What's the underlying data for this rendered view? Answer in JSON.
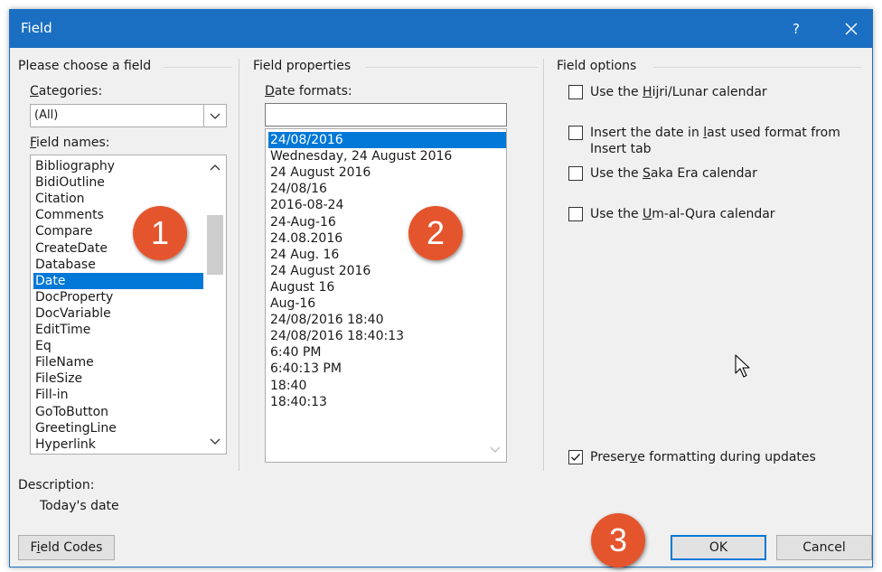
{
  "window": {
    "title": "Field",
    "help_label": "?"
  },
  "left": {
    "group_title": "Please choose a field",
    "categories_label": "Categories:",
    "categories_accel": "C",
    "categories_rest": "ategories:",
    "categories_value": "(All)",
    "field_names_accel": "F",
    "field_names_rest": "ield names:",
    "field_names": [
      "Bibliography",
      "BidiOutline",
      "Citation",
      "Comments",
      "Compare",
      "CreateDate",
      "Database",
      "Date",
      "DocProperty",
      "DocVariable",
      "EditTime",
      "Eq",
      "FileName",
      "FileSize",
      "Fill-in",
      "GoToButton",
      "GreetingLine",
      "Hyperlink"
    ],
    "selected_field": "Date",
    "description_label": "Description:",
    "description_text": "Today's date",
    "field_codes_accel": "i",
    "field_codes_pre": "F",
    "field_codes_post": "eld Codes"
  },
  "middle": {
    "group_title": "Field properties",
    "date_formats_accel": "D",
    "date_formats_rest": "ate formats:",
    "date_format_value": "",
    "date_formats": [
      "24/08/2016",
      "Wednesday, 24 August 2016",
      "24 August 2016",
      "24/08/16",
      "2016-08-24",
      "24-Aug-16",
      "24.08.2016",
      "24 Aug. 16",
      "24 August 2016",
      "August 16",
      "Aug-16",
      "24/08/2016 18:40",
      "24/08/2016 18:40:13",
      "6:40 PM",
      "6:40:13 PM",
      "18:40",
      "18:40:13"
    ],
    "selected_format": "24/08/2016"
  },
  "right": {
    "group_title": "Field options",
    "options": [
      {
        "pre": "Use the ",
        "accel": "H",
        "post": "ijri/Lunar calendar",
        "checked": false
      },
      {
        "pre": "Insert the date in ",
        "accel": "l",
        "post": "ast used format from",
        "line2": "Insert tab",
        "checked": false
      },
      {
        "pre": "Use the ",
        "accel": "S",
        "post": "aka Era calendar",
        "checked": false
      },
      {
        "pre": "Use the ",
        "accel": "U",
        "post": "m-al-Qura calendar",
        "checked": false
      }
    ],
    "preserve": {
      "pre": "Preser",
      "accel": "v",
      "post": "e formatting during updates",
      "checked": true
    }
  },
  "buttons": {
    "ok": "OK",
    "cancel": "Cancel"
  },
  "badges": [
    "1",
    "2",
    "3"
  ],
  "colors": {
    "titlebar": "#1b6fc2",
    "selection": "#0078d7",
    "badge": "#e5552d"
  }
}
